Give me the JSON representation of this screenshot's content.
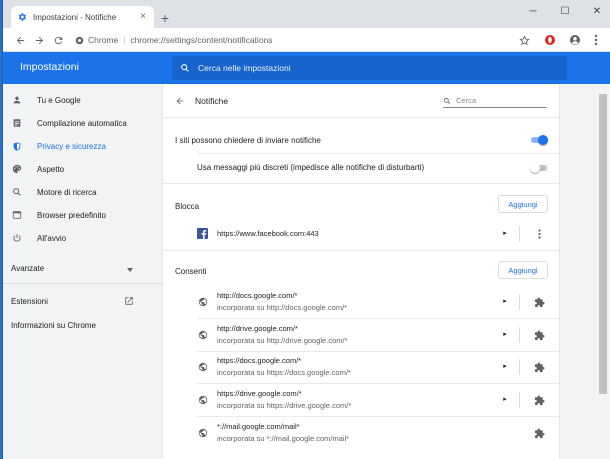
{
  "browser": {
    "tab_title": "Impostazioni - Notifiche",
    "omnibox_label": "Chrome",
    "omnibox_separator": "|",
    "url": "chrome://settings/content/notifications"
  },
  "settings": {
    "header_title": "Impostazioni",
    "search_placeholder": "Cerca nelle impostazioni",
    "sidebar": {
      "items": [
        {
          "label": "Tu e Google",
          "icon": "person-icon"
        },
        {
          "label": "Compilazione automatica",
          "icon": "clipboard-icon"
        },
        {
          "label": "Privacy e sicurezza",
          "icon": "shield-icon"
        },
        {
          "label": "Aspetto",
          "icon": "palette-icon"
        },
        {
          "label": "Motore di ricerca",
          "icon": "search-icon"
        },
        {
          "label": "Browser predefinito",
          "icon": "browser-icon"
        },
        {
          "label": "All'avvio",
          "icon": "power-icon"
        }
      ],
      "advanced": "Avanzate",
      "extensions": "Estensioni",
      "about": "Informazioni su Chrome"
    },
    "page": {
      "title": "Notifiche",
      "search_placeholder": "Cerca",
      "ask_label": "I siti possono chiedere di inviare notifiche",
      "ask_enabled": true,
      "quiet_label": "Usa messaggi più discreti (impedisce alle notifiche di disturbarti)",
      "quiet_enabled": false,
      "block": {
        "title": "Blocca",
        "add_label": "Aggiungi",
        "sites": [
          {
            "url": "https://www.facebook.com:443",
            "icon": "facebook-icon"
          }
        ]
      },
      "allow": {
        "title": "Consenti",
        "add_label": "Aggiungi",
        "sites": [
          {
            "url": "http://docs.google.com/*",
            "sub": "incorporata su http://docs.google.com/*"
          },
          {
            "url": "http://drive.google.com/*",
            "sub": "incorporata su http://drive.google.com/*"
          },
          {
            "url": "https://docs.google.com/*",
            "sub": "incorporata su https://docs.google.com/*"
          },
          {
            "url": "https://drive.google.com/*",
            "sub": "incorporata su https://drive.google.com/*"
          },
          {
            "url": "*://mail.google.com/mail*",
            "sub": "incorporata su *://mail.google.com/mail*"
          }
        ]
      }
    }
  },
  "colors": {
    "accent": "#1a73e8",
    "header_search": "#1765cc",
    "tabstrip": "#dee1e6",
    "content_bg": "#f1f3f4"
  }
}
